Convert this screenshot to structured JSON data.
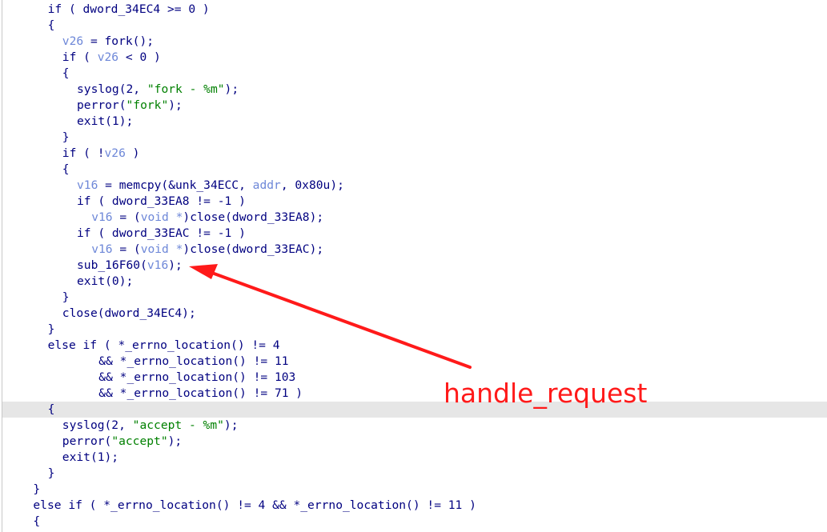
{
  "code": {
    "highlight_index": 25,
    "lines": [
      {
        "indent": 3,
        "segments": [
          {
            "t": "if ( dword_34EC4 >= 0 )"
          }
        ]
      },
      {
        "indent": 3,
        "segments": [
          {
            "t": "{"
          }
        ]
      },
      {
        "indent": 4,
        "segments": [
          {
            "t": "v26",
            "c": "var"
          },
          {
            "t": " = fork();"
          }
        ]
      },
      {
        "indent": 4,
        "segments": [
          {
            "t": "if ( "
          },
          {
            "t": "v26",
            "c": "var"
          },
          {
            "t": " < 0 )"
          }
        ]
      },
      {
        "indent": 4,
        "segments": [
          {
            "t": "{"
          }
        ]
      },
      {
        "indent": 5,
        "segments": [
          {
            "t": "syslog(2, "
          },
          {
            "t": "\"fork - %m\"",
            "c": "str"
          },
          {
            "t": ");"
          }
        ]
      },
      {
        "indent": 5,
        "segments": [
          {
            "t": "perror("
          },
          {
            "t": "\"fork\"",
            "c": "str"
          },
          {
            "t": ");"
          }
        ]
      },
      {
        "indent": 5,
        "segments": [
          {
            "t": "exit(1);"
          }
        ]
      },
      {
        "indent": 4,
        "segments": [
          {
            "t": "}"
          }
        ]
      },
      {
        "indent": 4,
        "segments": [
          {
            "t": "if ( !"
          },
          {
            "t": "v26",
            "c": "var"
          },
          {
            "t": " )"
          }
        ]
      },
      {
        "indent": 4,
        "segments": [
          {
            "t": "{"
          }
        ]
      },
      {
        "indent": 5,
        "segments": [
          {
            "t": "v16",
            "c": "var"
          },
          {
            "t": " = memcpy(&unk_34ECC, "
          },
          {
            "t": "addr",
            "c": "var"
          },
          {
            "t": ", 0x80u);"
          }
        ]
      },
      {
        "indent": 5,
        "segments": [
          {
            "t": "if ( dword_33EA8 != -1 )"
          }
        ]
      },
      {
        "indent": 6,
        "segments": [
          {
            "t": "v16",
            "c": "var"
          },
          {
            "t": " = ("
          },
          {
            "t": "void *",
            "c": "var"
          },
          {
            "t": ")close(dword_33EA8);"
          }
        ]
      },
      {
        "indent": 5,
        "segments": [
          {
            "t": "if ( dword_33EAC != -1 )"
          }
        ]
      },
      {
        "indent": 6,
        "segments": [
          {
            "t": "v16",
            "c": "var"
          },
          {
            "t": " = ("
          },
          {
            "t": "void *",
            "c": "var"
          },
          {
            "t": ")close(dword_33EAC);"
          }
        ]
      },
      {
        "indent": 5,
        "segments": [
          {
            "t": "sub_16F60("
          },
          {
            "t": "v16",
            "c": "var"
          },
          {
            "t": ");"
          }
        ]
      },
      {
        "indent": 5,
        "segments": [
          {
            "t": "exit(0);"
          }
        ]
      },
      {
        "indent": 4,
        "segments": [
          {
            "t": "}"
          }
        ]
      },
      {
        "indent": 4,
        "segments": [
          {
            "t": "close(dword_34EC4);"
          }
        ]
      },
      {
        "indent": 3,
        "segments": [
          {
            "t": "}"
          }
        ]
      },
      {
        "indent": 3,
        "segments": [
          {
            "t": "else if ( *_errno_location() != 4"
          }
        ]
      },
      {
        "indent": 6.5,
        "segments": [
          {
            "t": "&& *_errno_location() != 11"
          }
        ]
      },
      {
        "indent": 6.5,
        "segments": [
          {
            "t": "&& *_errno_location() != 103"
          }
        ]
      },
      {
        "indent": 6.5,
        "segments": [
          {
            "t": "&& *_errno_location() != 71 )"
          }
        ]
      },
      {
        "indent": 3,
        "segments": [
          {
            "t": "{"
          }
        ]
      },
      {
        "indent": 4,
        "segments": [
          {
            "t": "syslog(2, "
          },
          {
            "t": "\"accept - %m\"",
            "c": "str"
          },
          {
            "t": ");"
          }
        ]
      },
      {
        "indent": 4,
        "segments": [
          {
            "t": "perror("
          },
          {
            "t": "\"accept\"",
            "c": "str"
          },
          {
            "t": ");"
          }
        ]
      },
      {
        "indent": 4,
        "segments": [
          {
            "t": "exit(1);"
          }
        ]
      },
      {
        "indent": 3,
        "segments": [
          {
            "t": "}"
          }
        ]
      },
      {
        "indent": 2,
        "segments": [
          {
            "t": "}"
          }
        ]
      },
      {
        "indent": 2,
        "segments": [
          {
            "t": "else if ( *_errno_location() != 4 && *_errno_location() != 11 )"
          }
        ]
      },
      {
        "indent": 2,
        "segments": [
          {
            "t": "{"
          }
        ]
      }
    ]
  },
  "annotation": {
    "label": "handle_request",
    "color": "#ff1a1a",
    "target_line_index": 16
  },
  "colors": {
    "code_text": "#000080",
    "variable": "#6d87d8",
    "string": "#008000",
    "highlight_background": "#e6e6e6"
  }
}
